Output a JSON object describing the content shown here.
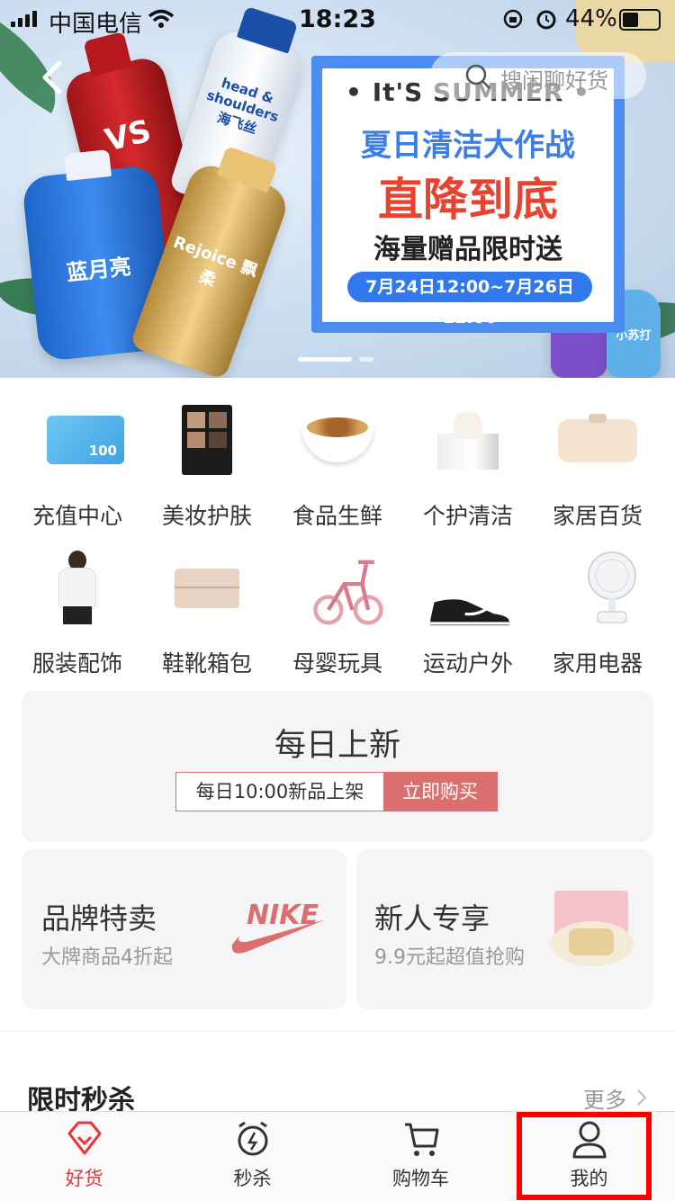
{
  "status_bar": {
    "carrier": "中国电信",
    "time": "18:23",
    "battery": "44%"
  },
  "banner": {
    "search_placeholder": "搜闲聊好货",
    "promo_line1": "• It'S SUMMER •",
    "promo_line2": "夏日清洁大作战",
    "promo_line3": "直降到底",
    "promo_line4": "海量赠品限时送",
    "promo_date": "7月24日12:00~7月26日12:00",
    "products": [
      "VS",
      "head & shoulders 海飞丝",
      "Rejoice 飘柔",
      "蓝月亮",
      "小苏打"
    ],
    "accent_blue": "#4a8cf0",
    "accent_red": "#e8432f"
  },
  "categories": [
    {
      "label": "充值中心",
      "icon": "recharge-card-icon"
    },
    {
      "label": "美妆护肤",
      "icon": "eyeshadow-palette-icon"
    },
    {
      "label": "食品生鲜",
      "icon": "food-bowl-icon"
    },
    {
      "label": "个护清洁",
      "icon": "tissue-box-icon"
    },
    {
      "label": "家居百货",
      "icon": "electric-pot-icon"
    },
    {
      "label": "服装配饰",
      "icon": "model-clothing-icon"
    },
    {
      "label": "鞋靴箱包",
      "icon": "handbag-icon"
    },
    {
      "label": "母婴玩具",
      "icon": "kids-bike-icon"
    },
    {
      "label": "运动户外",
      "icon": "sneaker-icon"
    },
    {
      "label": "家用电器",
      "icon": "desk-fan-icon"
    }
  ],
  "recharge_card_text": "100",
  "daily_new": {
    "title": "每日上新",
    "subtitle": "每日10:00新品上架",
    "button": "立即购买",
    "accent": "#d9706f"
  },
  "brand_sale": {
    "title": "品牌特卖",
    "subtitle": "大牌商品4折起",
    "logo_text": "NIKE"
  },
  "newcomer": {
    "title": "新人专享",
    "subtitle": "9.9元起超值抢购"
  },
  "flash_sale": {
    "title": "限时秒杀",
    "more": "更多"
  },
  "tabs": [
    {
      "label": "好货",
      "icon": "diamond-icon",
      "active": true
    },
    {
      "label": "秒杀",
      "icon": "alarm-clock-icon",
      "active": false
    },
    {
      "label": "购物车",
      "icon": "cart-icon",
      "active": false
    },
    {
      "label": "我的",
      "icon": "person-icon",
      "active": false
    }
  ],
  "colors": {
    "tab_active": "#e8353a",
    "highlight_box": "#ff0000"
  }
}
